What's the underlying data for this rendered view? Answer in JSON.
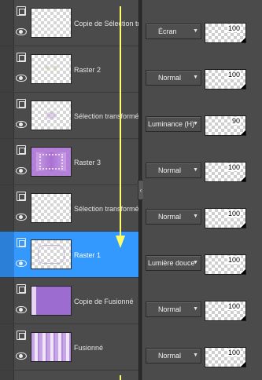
{
  "layers": [
    {
      "name": "Copie de Sélection transformée",
      "thumb": "checker",
      "selected": false
    },
    {
      "name": "Raster 2",
      "thumb": "checker-faint-dots",
      "selected": false
    },
    {
      "name": "Sélection transformée",
      "thumb": "checker-faint-center",
      "selected": false
    },
    {
      "name": "Raster 3",
      "thumb": "purple-frame",
      "selected": false
    },
    {
      "name": "Sélection transformée",
      "thumb": "checker",
      "selected": false
    },
    {
      "name": "Raster 1",
      "thumb": "checker-rounded-frame",
      "selected": true
    },
    {
      "name": "Copie de Fusionné",
      "thumb": "purple-gradient",
      "selected": false
    },
    {
      "name": "Fusionné",
      "thumb": "lavender-stripes",
      "selected": false
    }
  ],
  "properties": [
    {
      "blend": "Écran",
      "opacity": "100"
    },
    {
      "blend": "Normal",
      "opacity": "100"
    },
    {
      "blend": "Luminance (H)",
      "opacity": "90"
    },
    {
      "blend": "Normal",
      "opacity": "100"
    },
    {
      "blend": "Normal",
      "opacity": "100"
    },
    {
      "blend": "Lumière douce",
      "opacity": "100"
    },
    {
      "blend": "Normal",
      "opacity": "100"
    },
    {
      "blend": "Normal",
      "opacity": "100"
    }
  ],
  "icons": {
    "link": "link-icon",
    "visibility": "eye-icon",
    "dropdown": "chevron-down-icon",
    "splitter": "chevron-left-icon"
  },
  "colors": {
    "selection": "#3399ff",
    "panel": "#4b4b4b",
    "annotation_arrow": "#ffff66"
  }
}
